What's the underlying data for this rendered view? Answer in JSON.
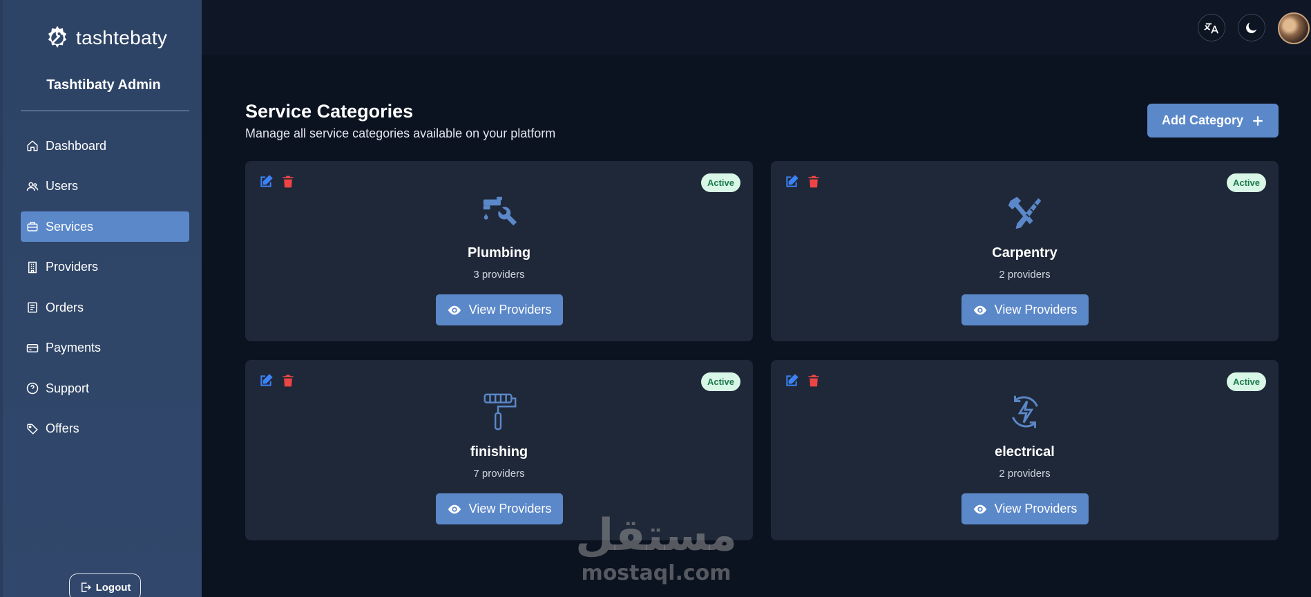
{
  "brand": {
    "name": "tashtebaty",
    "logo_icon": "gear-wrench-icon"
  },
  "sidebar": {
    "admin_title": "Tashtibaty Admin",
    "items": [
      {
        "label": "Dashboard",
        "icon": "home-icon",
        "active": false
      },
      {
        "label": "Users",
        "icon": "users-icon",
        "active": false
      },
      {
        "label": "Services",
        "icon": "briefcase-icon",
        "active": true
      },
      {
        "label": "Providers",
        "icon": "building-icon",
        "active": false
      },
      {
        "label": "Orders",
        "icon": "receipt-icon",
        "active": false
      },
      {
        "label": "Payments",
        "icon": "credit-card-icon",
        "active": false
      },
      {
        "label": "Support",
        "icon": "question-circle-icon",
        "active": false
      },
      {
        "label": "Offers",
        "icon": "tags-icon",
        "active": false
      }
    ],
    "logout_label": "Logout"
  },
  "header": {
    "icons": [
      "translate-icon",
      "moon-icon",
      "avatar"
    ]
  },
  "main": {
    "title": "Service Categories",
    "subtitle": "Manage all service categories available on your platform",
    "add_button_label": "Add Category",
    "categories": [
      {
        "name": "Plumbing",
        "count": "3 providers",
        "status": "Active",
        "icon": "faucet-wrench-icon",
        "button": "View Providers"
      },
      {
        "name": "Carpentry",
        "count": "2 providers",
        "status": "Active",
        "icon": "hammer-saw-icon",
        "button": "View Providers"
      },
      {
        "name": "finishing",
        "count": "7 providers",
        "status": "Active",
        "icon": "paint-roller-icon",
        "button": "View Providers"
      },
      {
        "name": "electrical",
        "count": "2 providers",
        "status": "Active",
        "icon": "lightning-cycle-icon",
        "button": "View Providers"
      }
    ]
  },
  "watermark": {
    "arabic": "مستقل",
    "latin": "mostaql.com"
  },
  "colors": {
    "sidebar": "#31476b",
    "accent": "#5b88c9",
    "card": "#1f2838",
    "background": "#0b1220",
    "edit": "#3b82f6",
    "delete": "#ef4444",
    "badge_bg": "#d9f7e7",
    "badge_text": "#1c7a4d"
  }
}
